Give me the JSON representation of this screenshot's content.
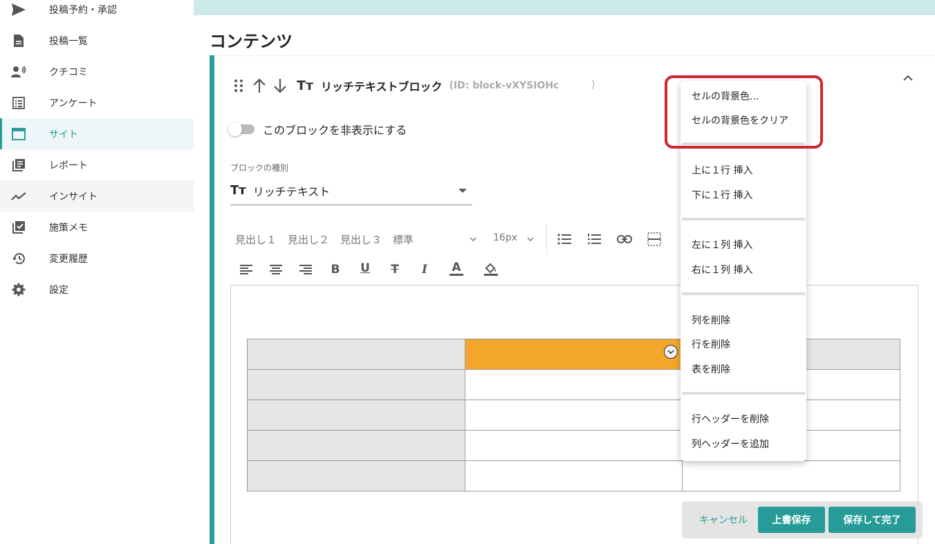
{
  "sidebar": {
    "items": [
      {
        "label": "投稿予約・承認",
        "icon": "send-icon"
      },
      {
        "label": "投稿一覧",
        "icon": "document-icon"
      },
      {
        "label": "クチコミ",
        "icon": "voice-person-icon"
      },
      {
        "label": "アンケート",
        "icon": "list-icon"
      },
      {
        "label": "サイト",
        "icon": "window-icon",
        "active": true
      },
      {
        "label": "レポート",
        "icon": "library-icon"
      },
      {
        "label": "インサイト",
        "icon": "trend-icon"
      },
      {
        "label": "施策メモ",
        "icon": "checkbox-icon"
      },
      {
        "label": "変更履歴",
        "icon": "history-icon"
      },
      {
        "label": "設定",
        "icon": "gear-icon"
      }
    ]
  },
  "page": {
    "title": "コンテンツ"
  },
  "block": {
    "title": "リッチテキストブロック",
    "id_text": "(ID: block-vXYSIOHc",
    "id_close": ")",
    "hide_toggle_label": "このブロックを非表示にする",
    "type_label": "ブロックの種別",
    "type_value": "リッチテキスト",
    "tt_glyph": "Tт"
  },
  "toolbar": {
    "heading1": "見出し１",
    "heading2": "見出し２",
    "heading3": "見出し３",
    "paragraph": "標準",
    "font_size": "16px",
    "bold": "B",
    "underline": "U",
    "strike": "T",
    "italic": "I",
    "font_color": "A"
  },
  "context_menu": {
    "items": [
      "セルの背景色...",
      "セルの背景色をクリア",
      "上に１行 挿入",
      "下に１行 挿入",
      "左に１列 挿入",
      "右に１列 挿入",
      "列を削除",
      "行を削除",
      "表を削除",
      "行ヘッダーを削除",
      "列ヘッダーを追加"
    ]
  },
  "actions": {
    "cancel": "キャンセル",
    "overwrite_save": "上書保存",
    "save_complete": "保存して完了"
  },
  "colors": {
    "accent": "#2a9d9a",
    "cell_highlight": "#f3a72a",
    "annotation": "#d0262e"
  }
}
